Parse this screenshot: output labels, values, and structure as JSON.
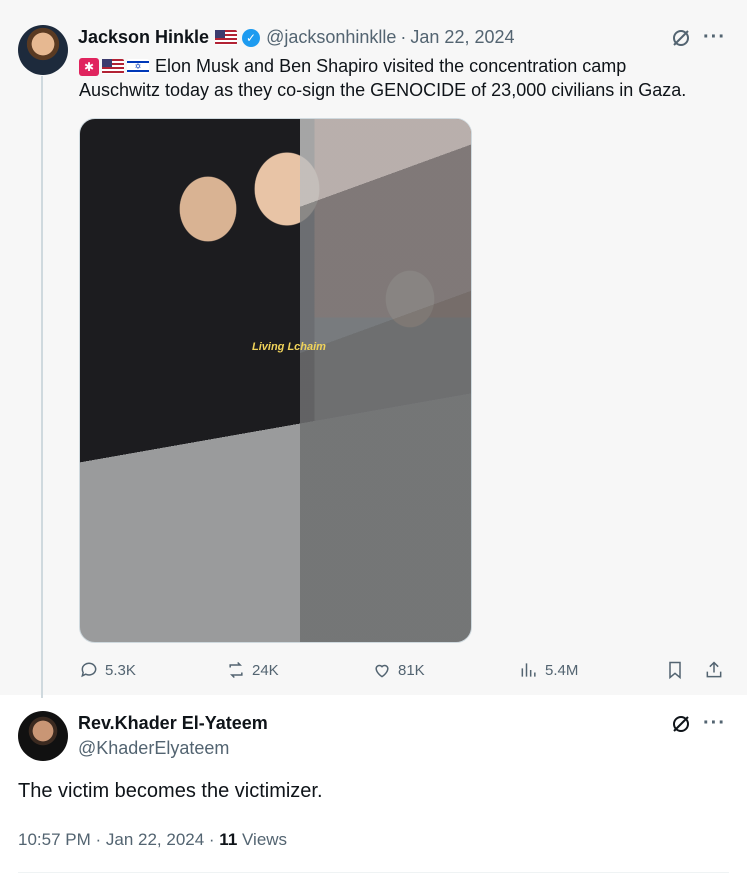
{
  "parent_tweet": {
    "author_name": "Jackson Hinkle",
    "handle": "@jacksonhinklle",
    "date": "Jan 22, 2024",
    "text_line1": "Elon Musk and Ben Shapiro visited the concentration camp",
    "text_line2": "Auschwitz today as they co-sign the GENOCIDE of 23,000 civilians in Gaza.",
    "media_watermark": "Living Lchaim",
    "stats": {
      "replies": "5.3K",
      "reposts": "24K",
      "likes": "81K",
      "views": "5.4M"
    }
  },
  "reply_tweet": {
    "author_name": "Rev.Khader El-Yateem",
    "handle": "@KhaderElyateem",
    "text": "The victim becomes the victimizer.",
    "time_date": "10:57 PM · Jan 22, 2024 · ",
    "views_count": "11",
    "views_label": " Views"
  },
  "icons": [
    "verified-badge-icon",
    "us-flag-icon",
    "siren-icon",
    "israel-flag-icon",
    "grok-icon",
    "more-icon",
    "reply-icon",
    "repost-icon",
    "like-icon",
    "views-icon",
    "bookmark-icon",
    "share-icon"
  ],
  "colors": {
    "verified": "#1d9bf0",
    "muted": "#536471",
    "text": "#0f1419",
    "parent_bg": "#f7f7f7"
  }
}
